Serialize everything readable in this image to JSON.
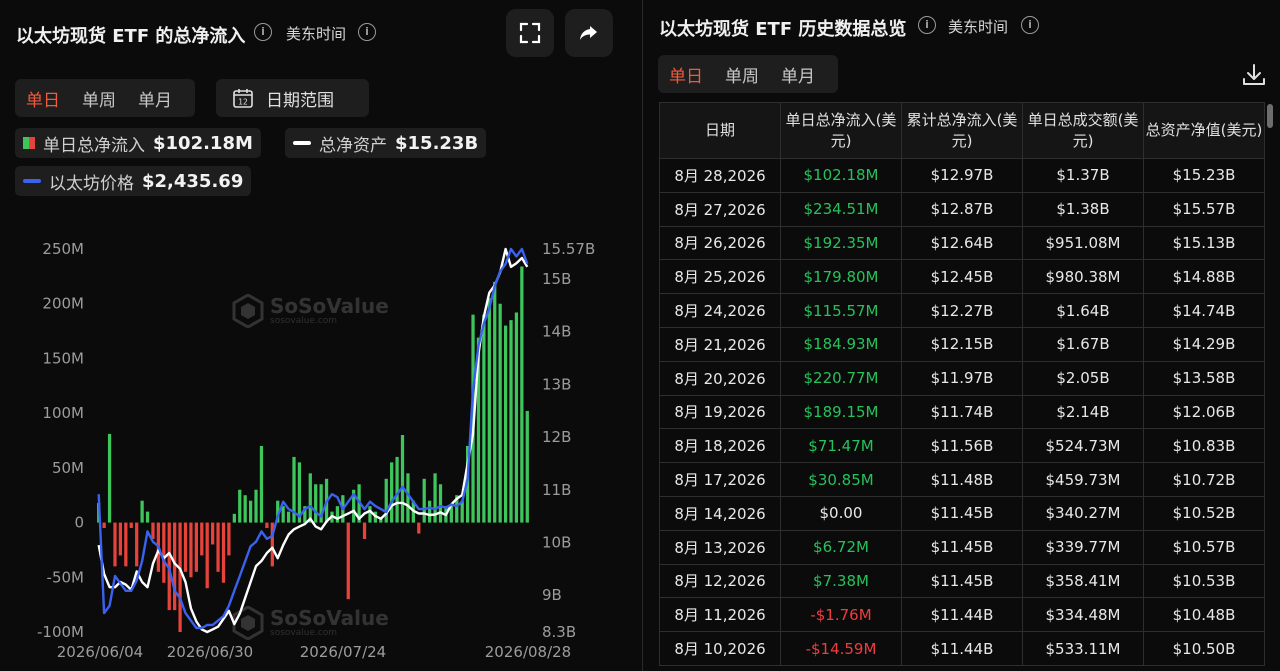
{
  "left": {
    "title": "以太坊现货 ETF 的总净流入",
    "timezone": "美东时间",
    "info_icon": "info-icon",
    "fullscreen_icon": "fullscreen-icon",
    "share_icon": "share-icon",
    "period_tabs": [
      "单日",
      "单周",
      "单月"
    ],
    "active_tab": 0,
    "date_range_label": "日期范围",
    "calendar_icon_text": "12",
    "legend": {
      "net_inflow_label": "单日总净流入",
      "net_inflow_value": "$102.18M",
      "net_assets_label": "总净资产",
      "net_assets_value": "$15.23B",
      "price_label": "以太坊价格",
      "price_value": "$2,435.69"
    },
    "watermark": {
      "name": "SoSoValue",
      "url": "sosovalue.com"
    }
  },
  "chart_data": {
    "type": "bar",
    "title": "以太坊现货 ETF 的总净流入",
    "y_left_ticks": [
      "250M",
      "200M",
      "150M",
      "100M",
      "50M",
      "0",
      "-50M",
      "-100M"
    ],
    "y_left_range": [
      -100,
      250
    ],
    "y_right_ticks": [
      "15.57B",
      "15B",
      "14B",
      "13B",
      "12B",
      "11B",
      "10B",
      "9B",
      "8.3B"
    ],
    "y_right_range": [
      8.3,
      15.57
    ],
    "x_ticks": [
      "2026/06/04",
      "2026/06/30",
      "2026/07/24",
      "2026/08/28"
    ],
    "colors": {
      "inflow": "#3ec65d",
      "outflow": "#e8433b",
      "net_assets": "#ffffff",
      "price": "#3a62ee"
    },
    "series": [
      {
        "name": "单日总净流入",
        "unit": "M USD",
        "values": [
          18,
          -5,
          81,
          -40,
          -30,
          -40,
          -5,
          -40,
          20,
          10,
          -15,
          -45,
          -55,
          -80,
          -80,
          -100,
          -45,
          -50,
          -45,
          -30,
          -60,
          -20,
          -45,
          -55,
          -30,
          8,
          30,
          25,
          20,
          30,
          70,
          -5,
          -40,
          20,
          15,
          10,
          60,
          55,
          15,
          45,
          35,
          35,
          40,
          10,
          15,
          25,
          -70,
          30,
          35,
          -15,
          15,
          10,
          5,
          40,
          55,
          60,
          80,
          45,
          20,
          -10,
          40,
          20,
          45,
          35,
          15,
          15,
          25,
          20,
          70,
          190,
          169,
          190,
          205,
          220,
          200,
          180,
          185,
          192,
          234,
          102
        ]
      },
      {
        "name": "总净资产",
        "unit": "B USD",
        "values": [
          9.95,
          9.4,
          9.15,
          9.15,
          9.25,
          9.2,
          9.1,
          9.45,
          9.25,
          9.15,
          9.6,
          9.85,
          9.7,
          9.8,
          9.6,
          9.5,
          9.25,
          8.75,
          8.5,
          8.35,
          8.3,
          8.35,
          8.4,
          8.55,
          8.7,
          8.45,
          8.65,
          8.95,
          9.25,
          9.55,
          9.65,
          9.8,
          9.9,
          9.7,
          9.95,
          10.15,
          10.25,
          10.3,
          10.35,
          10.45,
          10.3,
          10.25,
          10.4,
          10.5,
          10.45,
          10.5,
          10.55,
          10.6,
          10.45,
          10.55,
          10.6,
          10.5,
          10.45,
          10.55,
          10.7,
          10.75,
          10.75,
          10.7,
          10.6,
          10.55,
          10.55,
          10.52,
          10.53,
          10.57,
          10.52,
          10.72,
          10.83,
          10.9,
          11.5,
          12.06,
          13.58,
          14.29,
          14.74,
          14.88,
          15.13,
          15.57,
          15.23,
          15.3,
          15.4,
          15.23
        ]
      },
      {
        "name": "以太坊价格",
        "unit": "USD",
        "values": [
          2600,
          1800,
          1850,
          2050,
          2000,
          1950,
          1950,
          2020,
          2150,
          2350,
          2280,
          2250,
          2150,
          2100,
          1950,
          1900,
          1800,
          1750,
          1700,
          1700,
          1720,
          1720,
          1750,
          1780,
          1850,
          1950,
          2050,
          2150,
          2250,
          2280,
          2350,
          2300,
          2320,
          2450,
          2550,
          2500,
          2480,
          2450,
          2500,
          2520,
          2480,
          2450,
          2550,
          2600,
          2580,
          2500,
          2550,
          2600,
          2550,
          2500,
          2550,
          2520,
          2500,
          2480,
          2550,
          2600,
          2650,
          2600,
          2550,
          2500,
          2500,
          2510,
          2500,
          2520,
          2510,
          2530,
          2520,
          2550,
          2700,
          3300,
          3600,
          3750,
          3850,
          4000,
          4100,
          4150,
          4250,
          4200,
          4250,
          4150
        ]
      }
    ]
  },
  "right": {
    "title": "以太坊现货 ETF 历史数据总览",
    "timezone": "美东时间",
    "period_tabs": [
      "单日",
      "单周",
      "单月"
    ],
    "active_tab": 0,
    "download_icon": "download-icon",
    "columns": [
      "日期",
      "单日总净流入(美元)",
      "累计总净流入(美元)",
      "单日总成交额(美元)",
      "总资产净值(美元)"
    ],
    "rows": [
      [
        "8月 28,2026",
        "$102.18M",
        "$12.97B",
        "$1.37B",
        "$15.23B"
      ],
      [
        "8月 27,2026",
        "$234.51M",
        "$12.87B",
        "$1.38B",
        "$15.57B"
      ],
      [
        "8月 26,2026",
        "$192.35M",
        "$12.64B",
        "$951.08M",
        "$15.13B"
      ],
      [
        "8月 25,2026",
        "$179.80M",
        "$12.45B",
        "$980.38M",
        "$14.88B"
      ],
      [
        "8月 24,2026",
        "$115.57M",
        "$12.27B",
        "$1.64B",
        "$14.74B"
      ],
      [
        "8月 21,2026",
        "$184.93M",
        "$12.15B",
        "$1.67B",
        "$14.29B"
      ],
      [
        "8月 20,2026",
        "$220.77M",
        "$11.97B",
        "$2.05B",
        "$13.58B"
      ],
      [
        "8月 19,2026",
        "$189.15M",
        "$11.74B",
        "$2.14B",
        "$12.06B"
      ],
      [
        "8月 18,2026",
        "$71.47M",
        "$11.56B",
        "$524.73M",
        "$10.83B"
      ],
      [
        "8月 17,2026",
        "$30.85M",
        "$11.48B",
        "$459.73M",
        "$10.72B"
      ],
      [
        "8月 14,2026",
        "$0.00",
        "$11.45B",
        "$340.27M",
        "$10.52B"
      ],
      [
        "8月 13,2026",
        "$6.72M",
        "$11.45B",
        "$339.77M",
        "$10.57B"
      ],
      [
        "8月 12,2026",
        "$7.38M",
        "$11.45B",
        "$358.41M",
        "$10.53B"
      ],
      [
        "8月 11,2026",
        "-$1.76M",
        "$11.44B",
        "$334.48M",
        "$10.48B"
      ],
      [
        "8月 10,2026",
        "-$14.59M",
        "$11.44B",
        "$533.11M",
        "$10.50B"
      ]
    ]
  }
}
